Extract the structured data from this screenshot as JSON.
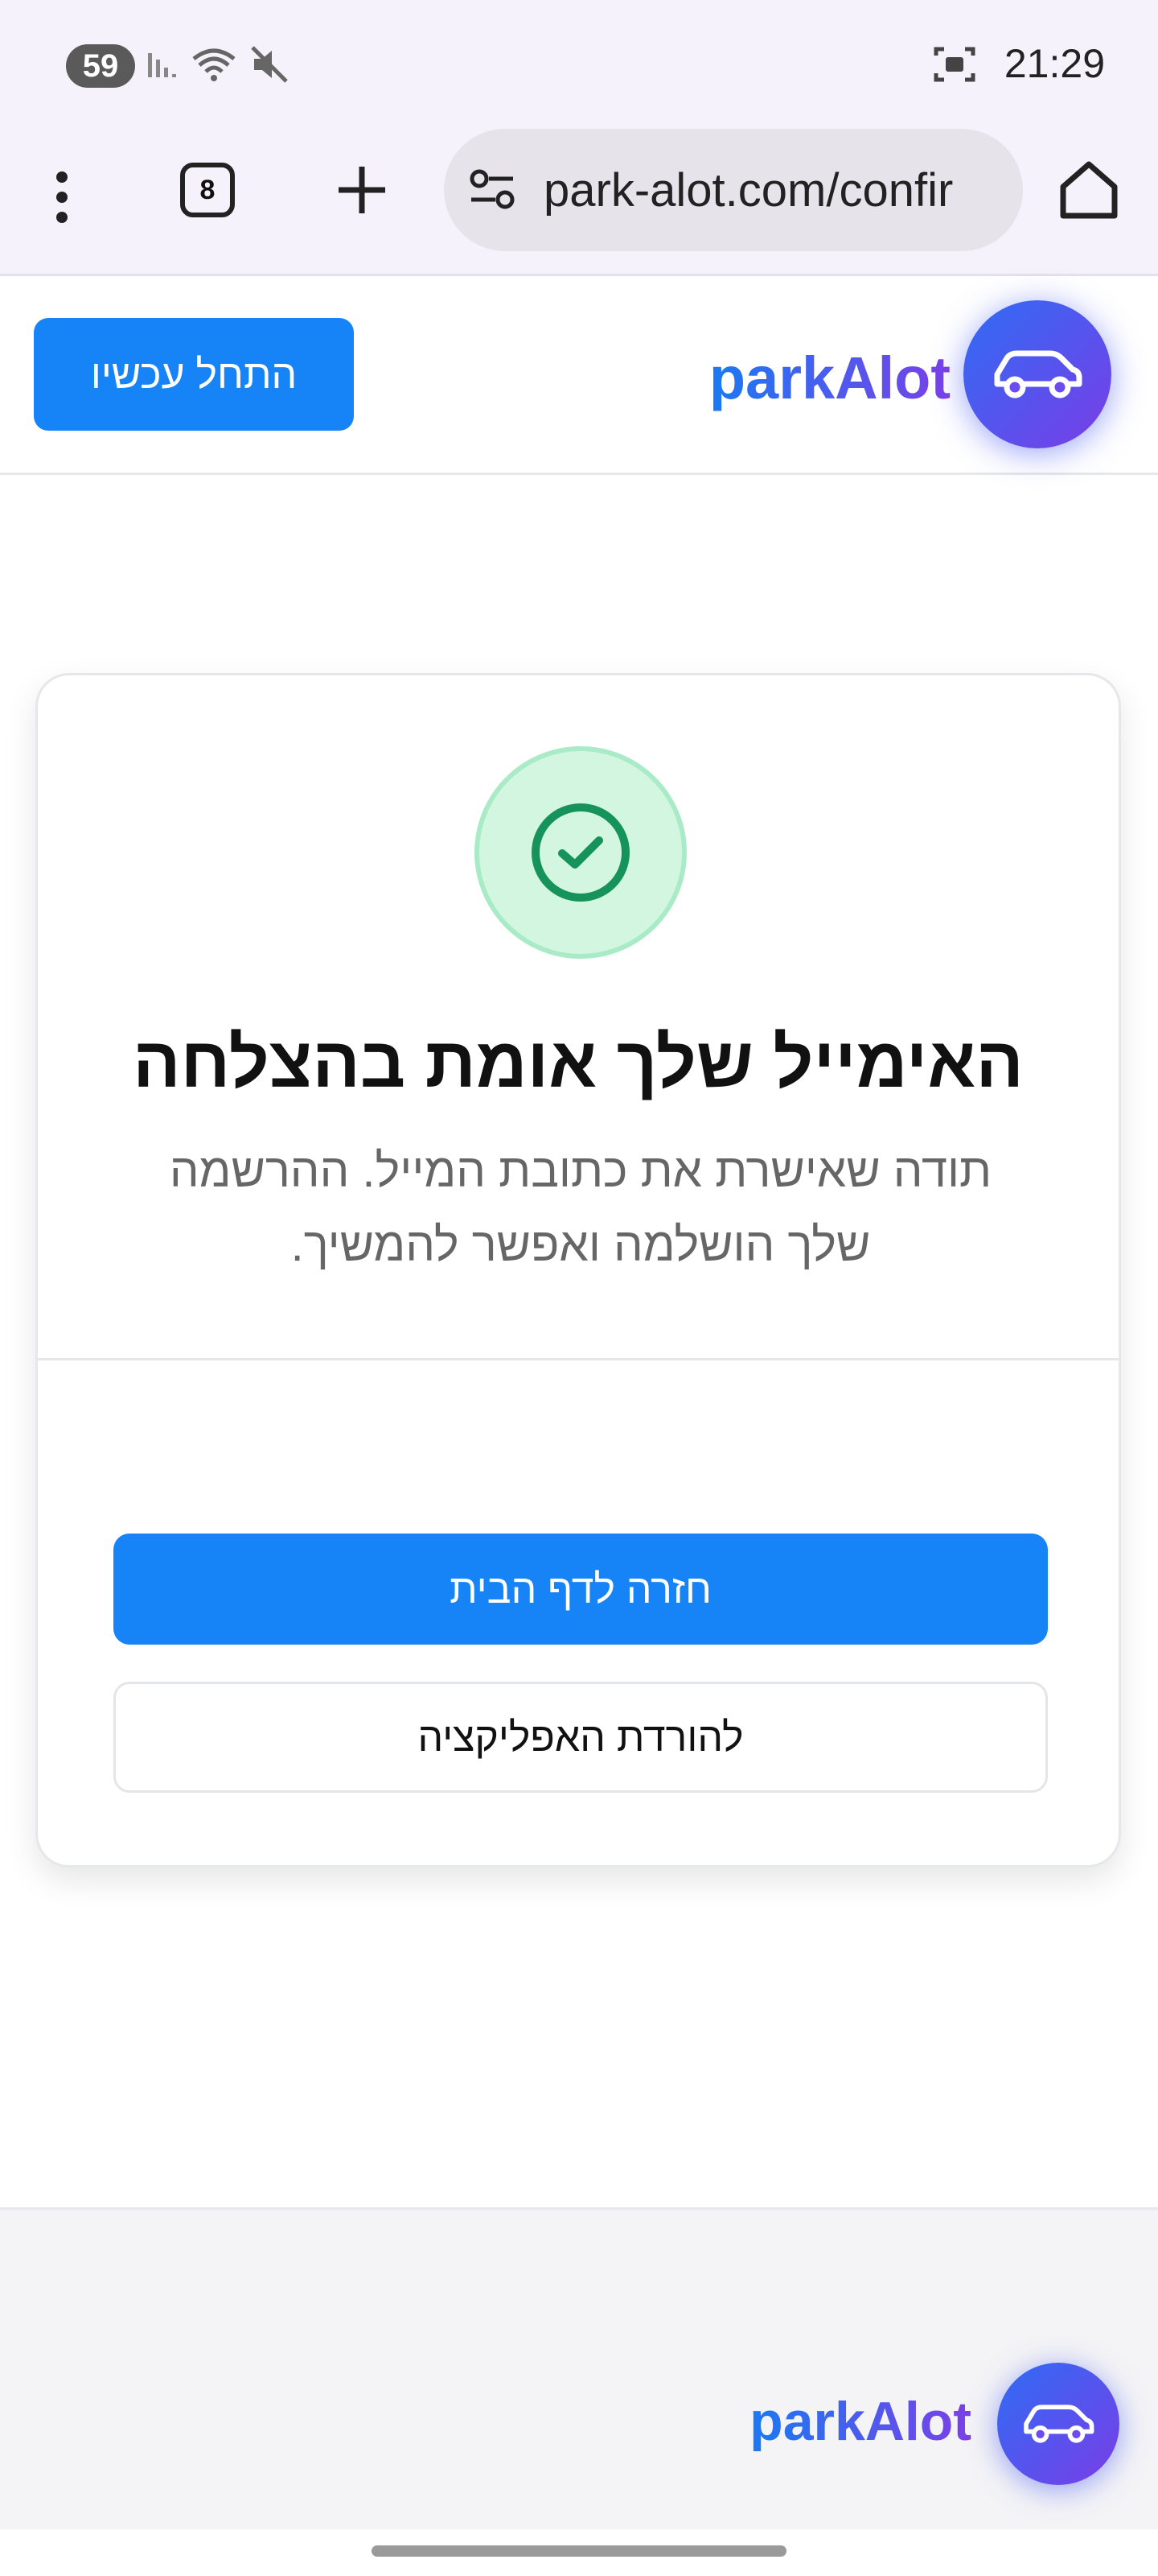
{
  "status_bar": {
    "battery": "59",
    "time": "21:29",
    "icons": [
      "signal-icon",
      "wifi-icon",
      "mute-icon",
      "screenshot-icon"
    ]
  },
  "browser": {
    "tab_count": "8",
    "url": "park-alot.com/confir",
    "icons": [
      "menu-dots-icon",
      "tabs-icon",
      "plus-icon",
      "site-settings-icon",
      "home-icon"
    ]
  },
  "header": {
    "logo_text": "parkAlot",
    "start_button": "התחל עכשיו",
    "logo_icon": "car-icon"
  },
  "card": {
    "icon": "check-circle-icon",
    "title": "האימייל שלך אומת בהצלחה",
    "description": "תודה שאישרת את כתובת המייל. ההרשמה שלך הושלמה ואפשר להמשיך.",
    "primary_button": "חזרה לדף הבית",
    "secondary_button": "להורדת האפליקציה"
  },
  "footer": {
    "logo_text": "parkAlot",
    "logo_icon": "car-icon"
  },
  "colors": {
    "primary": "#1683f7",
    "brand_gradient_start": "#1a7af3",
    "brand_gradient_end": "#7b3fe8",
    "success": "#15935a"
  }
}
